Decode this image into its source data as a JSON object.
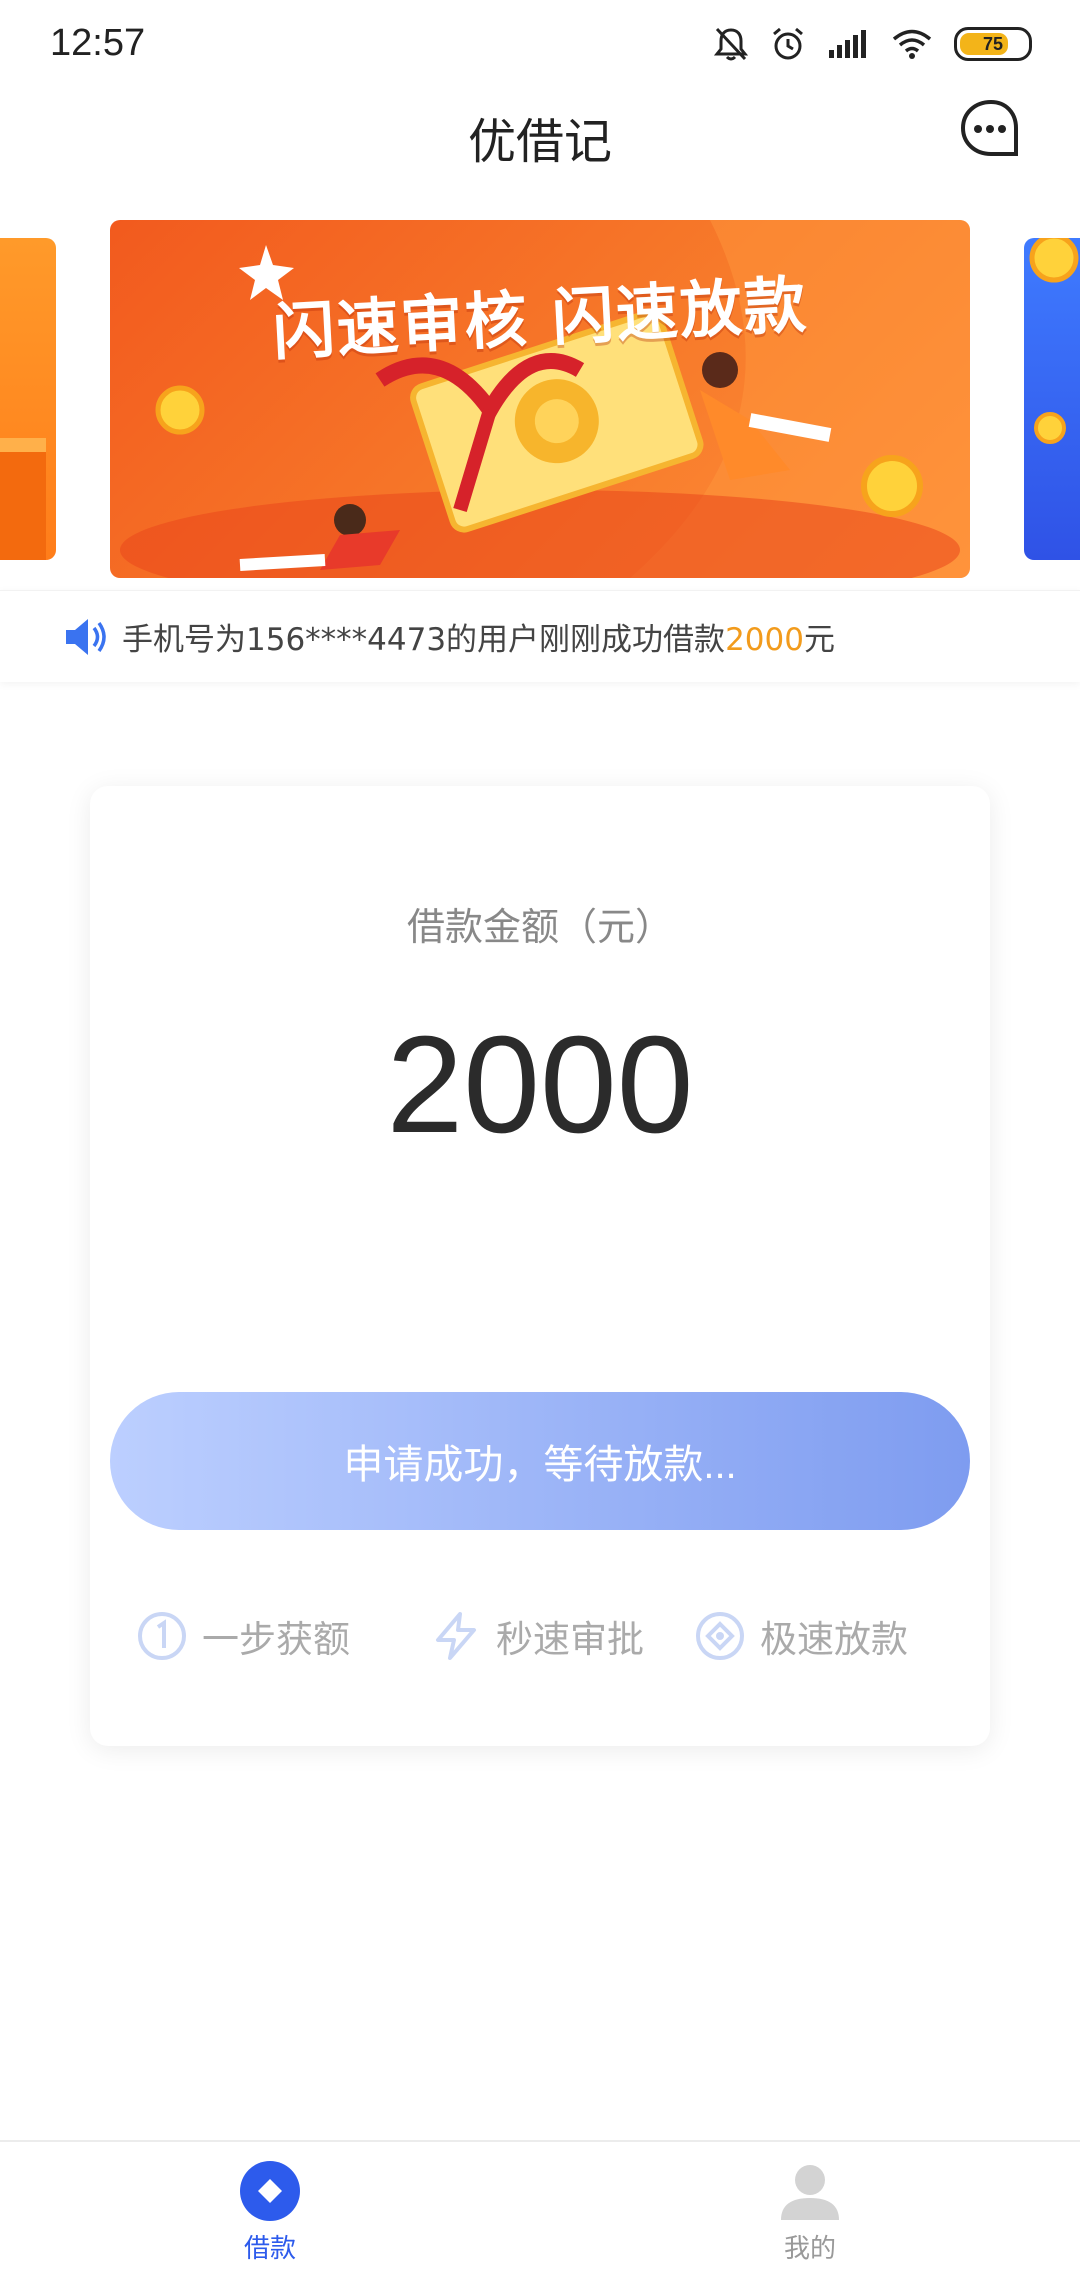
{
  "status_bar": {
    "time": "12:57",
    "battery": "75",
    "battery_level": 0.75,
    "icons": [
      "bell-muted-icon",
      "alarm-icon",
      "signal-icon",
      "wifi-icon",
      "battery-icon"
    ]
  },
  "header": {
    "title": "优借记",
    "message_icon": "chat-bubble-icon"
  },
  "banner": {
    "headline": "闪速审核 闪速放款",
    "colors": {
      "main": "#f25a1e",
      "left_peek": "#ff8a22",
      "right_peek": "#3a6cf5"
    }
  },
  "ticker": {
    "icon": "speaker-icon",
    "text_prefix": "手机号为156****4473的用户刚刚成功借款",
    "amount": "2000",
    "suffix": "元"
  },
  "loan_card": {
    "amount_label": "借款金额（元）",
    "amount_value": "2000",
    "status_button_label": "申请成功，等待放款...",
    "features": [
      {
        "icon": "number-one-circle-icon",
        "label": "一步获额"
      },
      {
        "icon": "lightning-icon",
        "label": "秒速审批"
      },
      {
        "icon": "diamond-circle-icon",
        "label": "极速放款"
      }
    ]
  },
  "bottom_nav": {
    "items": [
      {
        "icon": "loan-diamond-icon",
        "label": "借款",
        "active": true
      },
      {
        "icon": "profile-icon",
        "label": "我的",
        "active": false
      }
    ]
  },
  "colors": {
    "accent_blue": "#2d5bec",
    "ticker_amount": "#f29b1c",
    "button_gradient_start": "#bccfff",
    "button_gradient_end": "#7e9cf0"
  }
}
